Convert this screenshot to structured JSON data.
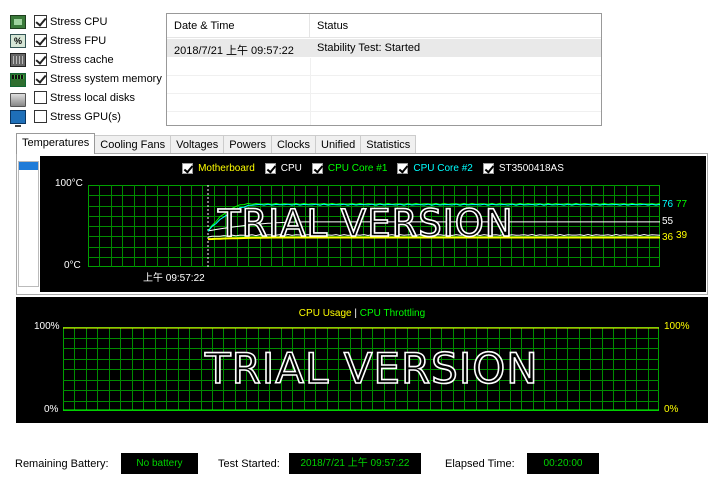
{
  "stress": {
    "items": [
      {
        "label": "Stress CPU",
        "checked": true,
        "icon": "cpu-icon"
      },
      {
        "label": "Stress FPU",
        "checked": true,
        "icon": "fpu-icon"
      },
      {
        "label": "Stress cache",
        "checked": true,
        "icon": "cache-icon"
      },
      {
        "label": "Stress system memory",
        "checked": true,
        "icon": "memory-icon"
      },
      {
        "label": "Stress local disks",
        "checked": false,
        "icon": "disk-icon"
      },
      {
        "label": "Stress GPU(s)",
        "checked": false,
        "icon": "gpu-icon"
      }
    ],
    "fpu_icon_text": "%"
  },
  "log": {
    "headers": {
      "date": "Date & Time",
      "status": "Status"
    },
    "rows": [
      {
        "date": "2018/7/21 上午 09:57:22",
        "status": "Stability Test: Started"
      }
    ]
  },
  "tabs": [
    "Temperatures",
    "Cooling Fans",
    "Voltages",
    "Powers",
    "Clocks",
    "Unified",
    "Statistics"
  ],
  "active_tab": "Temperatures",
  "temp_chart": {
    "legend": [
      {
        "label": "Motherboard",
        "color": "#ffff00"
      },
      {
        "label": "CPU",
        "color": "#ffffff"
      },
      {
        "label": "CPU Core #1",
        "color": "#00ff00"
      },
      {
        "label": "CPU Core #2",
        "color": "#00ffff"
      },
      {
        "label": "ST3500418AS",
        "color": "#ffffff"
      }
    ],
    "y_top": "100°C",
    "y_bottom": "0°C",
    "time_label": "上午 09:57:22",
    "values": {
      "v76": "76",
      "v77": "77",
      "v55": "55",
      "v36": "36",
      "v39": "39"
    },
    "watermark": "TRIAL VERSION"
  },
  "usage_chart": {
    "legend_usage": "CPU Usage",
    "legend_sep": "|",
    "legend_throttle": "CPU Throttling",
    "y_top_left": "100%",
    "y_bottom_left": "0%",
    "y_top_right": "100%",
    "y_bottom_right": "0%",
    "watermark": "TRIAL VERSION"
  },
  "status": {
    "battery_label": "Remaining Battery:",
    "battery_value": "No battery",
    "started_label": "Test Started:",
    "started_value": "2018/7/21 上午 09:57:22",
    "elapsed_label": "Elapsed Time:",
    "elapsed_value": "00:20:00"
  },
  "chart_data": [
    {
      "type": "line",
      "title": "",
      "ylim": [
        0,
        100
      ],
      "ylabel": "",
      "series": [
        {
          "name": "Motherboard",
          "color": "#ffff00",
          "last_value": 36
        },
        {
          "name": "CPU",
          "color": "#ffffff",
          "last_value": 55
        },
        {
          "name": "CPU Core #1",
          "color": "#00ff00",
          "last_value": 77
        },
        {
          "name": "CPU Core #2",
          "color": "#00ffff",
          "last_value": 76
        },
        {
          "name": "ST3500418AS",
          "color": "#ffffff",
          "last_value": 39
        }
      ]
    },
    {
      "type": "line",
      "title": "",
      "ylim": [
        0,
        100
      ],
      "series": [
        {
          "name": "CPU Usage",
          "color": "#ffff00",
          "last_value": 100
        },
        {
          "name": "CPU Throttling",
          "color": "#00ff00",
          "last_value": 0
        }
      ]
    }
  ]
}
